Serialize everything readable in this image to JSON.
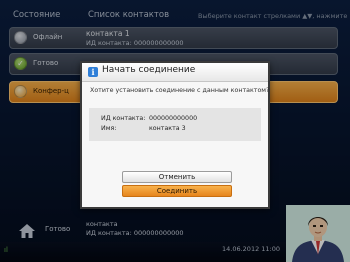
{
  "header": {
    "col_status": "Состояние",
    "col_contacts": "Список контактов",
    "hint": "Выберите контакт стрелками ▲▼, нажмите Пуск+"
  },
  "rows": [
    {
      "status": "Офлайн",
      "name": "контакта 1",
      "id": "ИД контакта: 000000000000",
      "color": "#4c5565",
      "icon": "grey-dot-icon"
    },
    {
      "status": "Готово",
      "name": "",
      "id": "",
      "color": "#4c5565",
      "icon": "green-check-icon",
      "check": "✓"
    },
    {
      "status": "Конфер-ц",
      "name": "",
      "id": "",
      "color": "#f2a238",
      "icon": "orange-dot-icon"
    }
  ],
  "bottom": {
    "status": "Готово",
    "name": "контакта",
    "id": "ИД контакта: 000000000000",
    "datetime": "14.06.2012 11:00",
    "signal": "ıl"
  },
  "dialog": {
    "icon": "i",
    "title": "Начать соединение",
    "question": "Хотите установить соединение с данным контактом?",
    "id_label": "ИД контакта:",
    "id_value": "000000000000",
    "name_label": "Имя:",
    "name_value": "контакта 3",
    "cancel_label": "Отменить",
    "connect_label": "Соединить"
  },
  "colors": {
    "accent": "#f2a238",
    "background": "#0c1f40",
    "info_icon": "#2f7fd8"
  }
}
